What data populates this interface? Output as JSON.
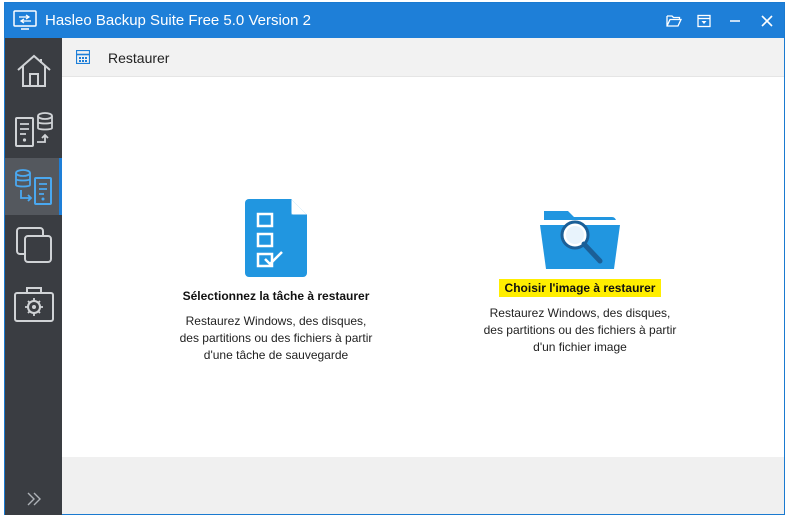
{
  "window": {
    "title": "Hasleo Backup Suite Free 5.0 Version 2"
  },
  "titlebar_buttons": [
    {
      "name": "open-folder-icon"
    },
    {
      "name": "menu-icon"
    },
    {
      "name": "minimize-icon"
    },
    {
      "name": "close-icon"
    }
  ],
  "sidebar": {
    "items": [
      {
        "name": "home-icon",
        "active": false
      },
      {
        "name": "backup-icon",
        "active": false
      },
      {
        "name": "restore-icon",
        "active": true
      },
      {
        "name": "clone-icon",
        "active": false
      },
      {
        "name": "tools-icon",
        "active": false
      }
    ],
    "expand_icon": "double-chevron-right-icon"
  },
  "page": {
    "title": "Restaurer"
  },
  "options": [
    {
      "title": "Sélectionnez la tâche à restaurer",
      "desc": [
        "Restaurez Windows, des disques,",
        "des partitions ou des fichiers à partir",
        "d'une tâche de sauvegarde"
      ],
      "highlighted": false
    },
    {
      "title": "Choisir l'image à restaurer",
      "desc": [
        "Restaurez Windows, des disques,",
        "des partitions ou des fichiers à partir",
        "d'un fichier image"
      ],
      "highlighted": true
    }
  ],
  "colors": {
    "accent": "#1e7fd8",
    "sidebar": "#3a3d42",
    "highlight": "#ffee00",
    "icon_blue": "#2196e0"
  }
}
